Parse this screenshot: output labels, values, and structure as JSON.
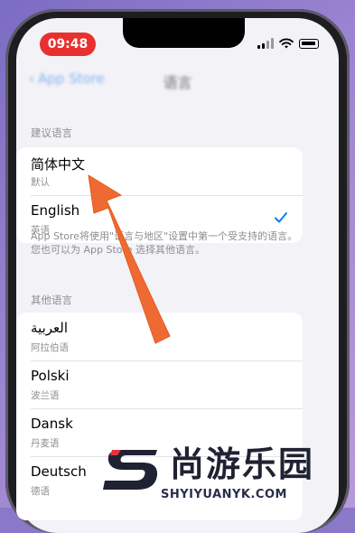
{
  "status_bar": {
    "time": "09:48"
  },
  "nav": {
    "back_label": "App Store",
    "title": "语言"
  },
  "suggested": {
    "header": "建议语言",
    "rows": [
      {
        "name": "简体中文",
        "sub": "默认",
        "checked": false
      },
      {
        "name": "English",
        "sub": "英语",
        "checked": true
      }
    ]
  },
  "footnote": "App Store将使用\"语言与地区\"设置中第一个受支持的语言。您也可以为 App Store 选择其他语言。",
  "other": {
    "header": "其他语言",
    "rows": [
      {
        "name": "العربية",
        "sub": "阿拉伯语"
      },
      {
        "name": "Polski",
        "sub": "波兰语"
      },
      {
        "name": "Dansk",
        "sub": "丹麦语"
      },
      {
        "name": "Deutsch",
        "sub": "德语"
      }
    ]
  },
  "watermark": {
    "brand": "尚游乐园",
    "url": "SHYIYUANYK.COM"
  },
  "colors": {
    "accent": "#007aff",
    "arrow": "#ef6a32",
    "time_pill": "#e8312f"
  }
}
